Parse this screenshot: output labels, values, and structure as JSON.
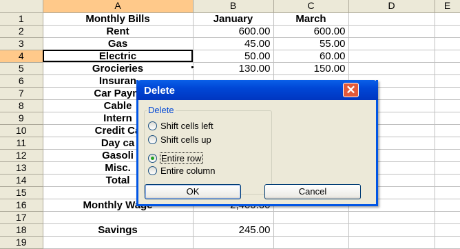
{
  "columns": [
    "A",
    "B",
    "C",
    "D",
    "E"
  ],
  "active_column": "A",
  "active_row": "4",
  "rows": [
    {
      "num": "1",
      "a": "Monthly Bills",
      "b": "January",
      "c": "March"
    },
    {
      "num": "2",
      "a": "Rent",
      "b": "600.00",
      "c": "600.00"
    },
    {
      "num": "3",
      "a": "Gas",
      "b": "45.00",
      "c": "55.00"
    },
    {
      "num": "4",
      "a": "Electric",
      "b": "50.00",
      "c": "60.00"
    },
    {
      "num": "5",
      "a": "Grocieries",
      "b": "130.00",
      "c": "150.00"
    },
    {
      "num": "6",
      "a": "Insuran",
      "b": "",
      "c": ""
    },
    {
      "num": "7",
      "a": "Car Paym",
      "b": "",
      "c": ""
    },
    {
      "num": "8",
      "a": "Cable",
      "b": "",
      "c": ""
    },
    {
      "num": "9",
      "a": "Intern",
      "b": "",
      "c": ""
    },
    {
      "num": "10",
      "a": "Credit Ca",
      "b": "",
      "c": ""
    },
    {
      "num": "11",
      "a": "Day ca",
      "b": "",
      "c": ""
    },
    {
      "num": "12",
      "a": "Gasoli",
      "b": "",
      "c": ""
    },
    {
      "num": "13",
      "a": "Misc.",
      "b": "",
      "c": ""
    },
    {
      "num": "14",
      "a": "Total",
      "b": "",
      "c": ""
    },
    {
      "num": "15",
      "a": "",
      "b": "",
      "c": ""
    },
    {
      "num": "16",
      "a": "Monthly Wage",
      "b": "2,400.00",
      "c": ""
    },
    {
      "num": "17",
      "a": "",
      "b": "",
      "c": ""
    },
    {
      "num": "18",
      "a": "Savings",
      "b": "245.00",
      "c": ""
    },
    {
      "num": "19",
      "a": "",
      "b": "",
      "c": ""
    }
  ],
  "dialog": {
    "title": "Delete",
    "close_icon": "close-icon",
    "group_label": "Delete",
    "options": [
      {
        "label": "Shift cells left",
        "checked": false
      },
      {
        "label": "Shift cells up",
        "checked": false
      },
      {
        "label": "Entire row",
        "checked": true
      },
      {
        "label": "Entire column",
        "checked": false
      }
    ],
    "ok_label": "OK",
    "cancel_label": "Cancel"
  },
  "colors": {
    "header_bg": "#ece9d8",
    "active_header_bg": "#ffc98a",
    "title_bar": "#0047d6",
    "close_button": "#e35a3a",
    "radio_dot": "#21a121"
  }
}
